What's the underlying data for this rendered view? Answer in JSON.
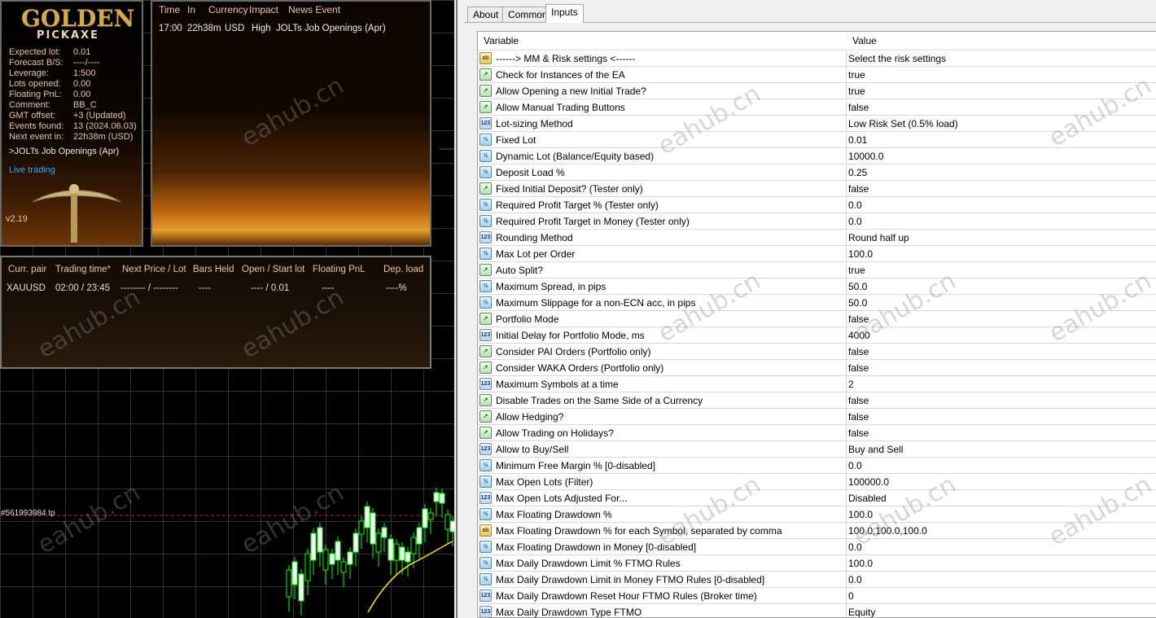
{
  "chart": {
    "logo": {
      "title": "GOLDEN",
      "subtitle": "PICKAXE"
    },
    "stats": [
      {
        "label": "Expected lot:",
        "value": "0.01"
      },
      {
        "label": "Forecast B/S:",
        "value": "----/----"
      },
      {
        "label": "Leverage:",
        "value": "1:500"
      },
      {
        "label": "Lots opened:",
        "value": "0.00"
      },
      {
        "label": "Floating PnL:",
        "value": "0.00"
      },
      {
        "label": "Comment:",
        "value": "BB_C"
      },
      {
        "label": "GMT offset:",
        "value": "+3 (Updated)"
      },
      {
        "label": "Events found:",
        "value": "13 (2024.06.03)"
      },
      {
        "label": "Next event in:",
        "value": "22h38m (USD)"
      }
    ],
    "next_event": ">JOLTs Job Openings (Apr)",
    "live_trading": "Live trading",
    "version": "v2.19",
    "news": {
      "headers": {
        "time": "Time",
        "in": "In",
        "currency": "Currency",
        "impact": "Impact",
        "event": "News Event"
      },
      "row": {
        "time": "17:00",
        "in": "22h38m",
        "currency": "USD",
        "impact": "High",
        "event": "JOLTs Job Openings (Apr)"
      }
    },
    "trade_table": {
      "headers": [
        "Curr. pair",
        "Trading time*",
        "Next Price / Lot",
        "Bars Held",
        "Open / Start lot",
        "Floating PnL",
        "Dep. load"
      ],
      "row": [
        "XAUUSD",
        "02:00 / 23:45",
        "-------- / --------",
        "----",
        "---- / 0.01",
        "----",
        "----%"
      ]
    },
    "line_label": "#561993984 tp",
    "watermark": "eahub.cn"
  },
  "dialog": {
    "tabs": [
      "About",
      "Common",
      "Inputs"
    ],
    "active_tab": "Inputs",
    "columns": {
      "variable": "Variable",
      "value": "Value"
    },
    "rows": [
      {
        "icon": "ab",
        "variable": "------> MM & Risk settings <------",
        "value": "Select the risk settings"
      },
      {
        "icon": "bool",
        "variable": "Check for Instances of the EA",
        "value": "true"
      },
      {
        "icon": "bool",
        "variable": "Allow Opening a new Initial Trade?",
        "value": "true"
      },
      {
        "icon": "bool",
        "variable": "Allow Manual Trading Buttons",
        "value": "false"
      },
      {
        "icon": "123",
        "variable": "Lot-sizing Method",
        "value": "Low Risk Set (0.5% load)"
      },
      {
        "icon": "dbl",
        "variable": "Fixed Lot",
        "value": "0.01"
      },
      {
        "icon": "dbl",
        "variable": "Dynamic Lot (Balance/Equity based)",
        "value": "10000.0"
      },
      {
        "icon": "dbl",
        "variable": "Deposit Load %",
        "value": "0.25"
      },
      {
        "icon": "bool",
        "variable": "Fixed Initial Deposit? (Tester only)",
        "value": "false"
      },
      {
        "icon": "dbl",
        "variable": "Required Profit Target % (Tester only)",
        "value": "0.0"
      },
      {
        "icon": "dbl",
        "variable": "Required Profit Target in Money (Tester only)",
        "value": "0.0"
      },
      {
        "icon": "123",
        "variable": "Rounding Method",
        "value": "Round half up"
      },
      {
        "icon": "dbl",
        "variable": "Max Lot per Order",
        "value": "100.0"
      },
      {
        "icon": "bool",
        "variable": "Auto Split?",
        "value": "true"
      },
      {
        "icon": "dbl",
        "variable": "Maximum Spread, in pips",
        "value": "50.0"
      },
      {
        "icon": "dbl",
        "variable": "Maximum Slippage for a non-ECN acc, in pips",
        "value": "50.0"
      },
      {
        "icon": "bool",
        "variable": "Portfolio Mode",
        "value": "false"
      },
      {
        "icon": "123",
        "variable": "Initial Delay for Portfolio Mode, ms",
        "value": "4000"
      },
      {
        "icon": "bool",
        "variable": "Consider PAI Orders (Portfolio only)",
        "value": "false"
      },
      {
        "icon": "bool",
        "variable": "Consider WAKA Orders (Portfolio only)",
        "value": "false"
      },
      {
        "icon": "123",
        "variable": "Maximum Symbols at a time",
        "value": "2"
      },
      {
        "icon": "bool",
        "variable": "Disable Trades on the Same Side of a Currency",
        "value": "false"
      },
      {
        "icon": "bool",
        "variable": "Allow Hedging?",
        "value": "false"
      },
      {
        "icon": "bool",
        "variable": "Allow Trading on Holidays?",
        "value": "false"
      },
      {
        "icon": "123",
        "variable": "Allow to Buy/Sell",
        "value": "Buy and Sell"
      },
      {
        "icon": "dbl",
        "variable": "Minimum Free Margin % [0-disabled]",
        "value": "0.0"
      },
      {
        "icon": "dbl",
        "variable": "Max Open Lots (Filter)",
        "value": "100000.0"
      },
      {
        "icon": "123",
        "variable": "Max Open Lots Adjusted For...",
        "value": "Disabled"
      },
      {
        "icon": "dbl",
        "variable": "Max Floating Drawdown %",
        "value": "100.0"
      },
      {
        "icon": "ab",
        "variable": "Max Floating Drawdown % for each Symbol, separated by comma",
        "value": "100.0,100.0,100.0"
      },
      {
        "icon": "dbl",
        "variable": "Max Floating Drawdown in Money [0-disabled]",
        "value": "0.0"
      },
      {
        "icon": "dbl",
        "variable": "Max Daily Drawdown Limit % FTMO Rules",
        "value": "100.0"
      },
      {
        "icon": "dbl",
        "variable": "Max Daily Drawdown Limit in Money FTMO Rules [0-disabled]",
        "value": "0.0"
      },
      {
        "icon": "123",
        "variable": "Max Daily Drawdown Reset Hour FTMO Rules (Broker time)",
        "value": "0"
      },
      {
        "icon": "123",
        "variable": "Max Daily Drawdown Type FTMO",
        "value": "Equity"
      }
    ]
  }
}
